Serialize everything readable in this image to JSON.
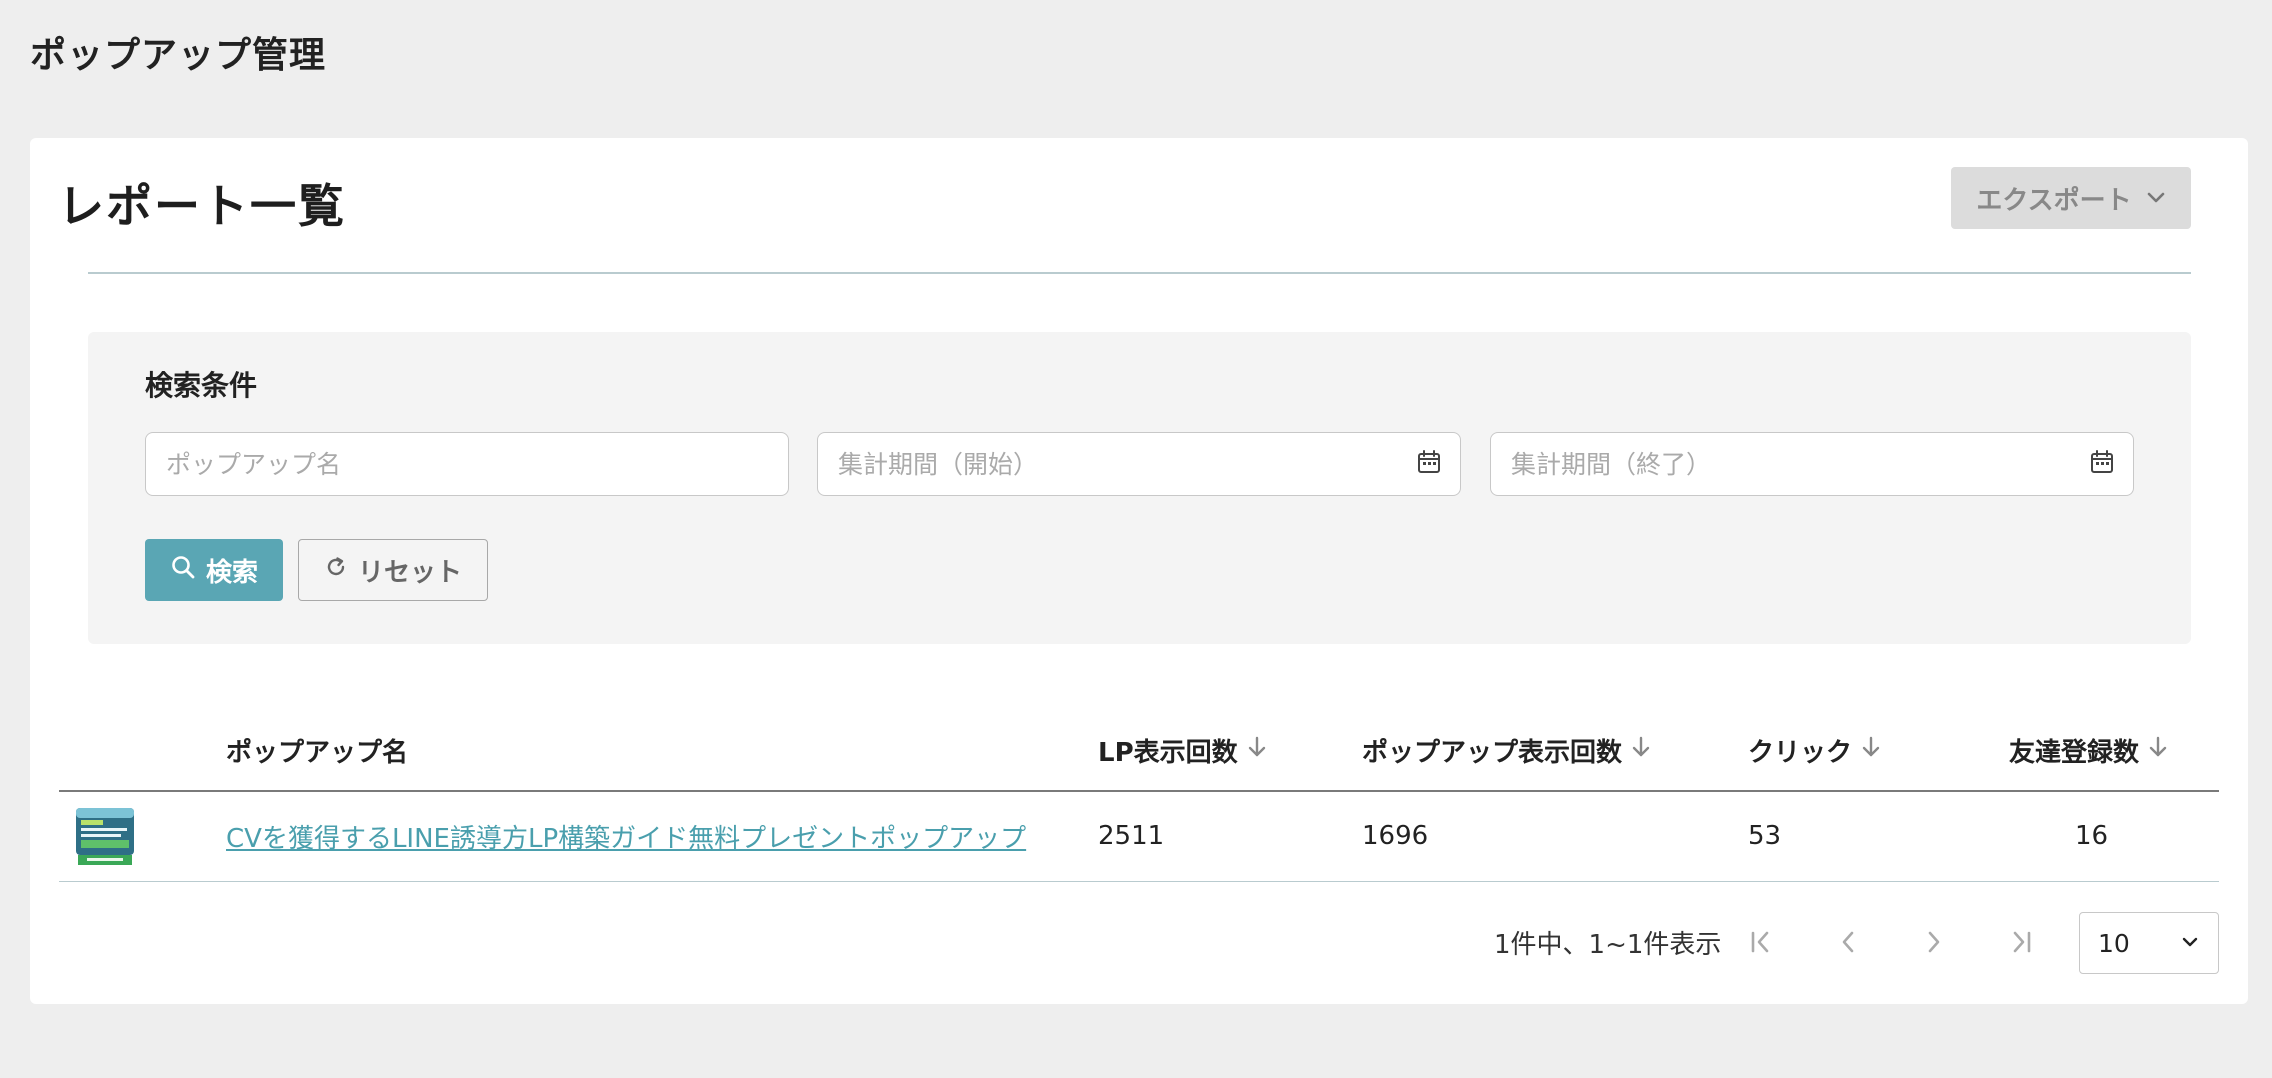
{
  "page": {
    "title": "ポップアップ管理"
  },
  "report": {
    "title": "レポート一覧",
    "export_label": "エクスポート"
  },
  "search": {
    "heading": "検索条件",
    "name_placeholder": "ポップアップ名",
    "start_placeholder": "集計期間（開始）",
    "end_placeholder": "集計期間（終了）",
    "search_label": "検索",
    "reset_label": "リセット"
  },
  "table": {
    "columns": {
      "name": "ポップアップ名",
      "lp_views": "LP表示回数",
      "popup_views": "ポップアップ表示回数",
      "clicks": "クリック",
      "friends": "友達登録数"
    },
    "rows": [
      {
        "name": "CVを獲得するLINE誘導方LP構築ガイド無料プレゼントポップアップ",
        "lp_views": "2511",
        "popup_views": "1696",
        "clicks": "53",
        "friends": "16"
      }
    ]
  },
  "pagination": {
    "info": "1件中、1~1件表示",
    "per_page": "10"
  },
  "colors": {
    "accent": "#5aa6b4",
    "link": "#4a9fad",
    "background": "#eeeeee"
  },
  "icons": {
    "export_chevron": "chevron-down-icon",
    "calendar": "calendar-icon",
    "search": "search-icon",
    "reset": "refresh-icon",
    "sort": "arrow-down-icon",
    "first": "first-page-icon",
    "prev": "chevron-left-icon",
    "next": "chevron-right-icon",
    "last": "last-page-icon"
  }
}
